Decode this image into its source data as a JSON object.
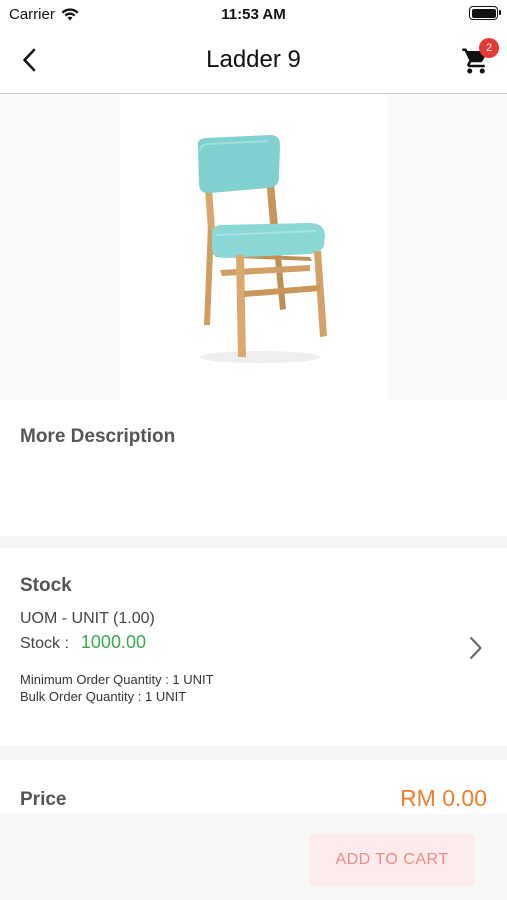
{
  "status_bar": {
    "carrier": "Carrier",
    "time": "11:53 AM"
  },
  "nav": {
    "title": "Ladder 9",
    "cart_count": "2"
  },
  "description": {
    "title": "More Description"
  },
  "stock": {
    "title": "Stock",
    "uom": "UOM - UNIT (1.00)",
    "stock_label": "Stock :",
    "stock_value": "1000.00",
    "min_order": "Minimum Order Quantity : 1 UNIT",
    "bulk_order": "Bulk Order Quantity : 1 UNIT"
  },
  "price": {
    "title": "Price",
    "value": "RM 0.00"
  },
  "actions": {
    "add_to_cart": "ADD TO CART"
  },
  "colors": {
    "accent_price": "#f07d2c",
    "stock_green": "#3aa84a",
    "badge_red": "#e53935"
  }
}
